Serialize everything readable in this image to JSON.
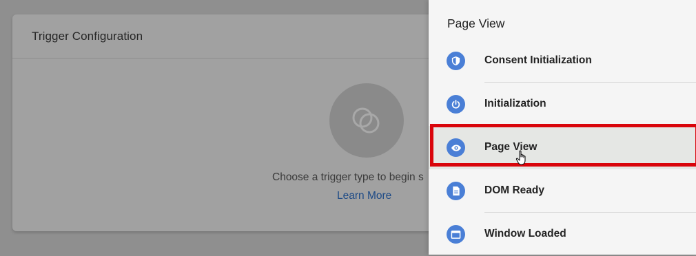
{
  "background_card": {
    "title": "Trigger Configuration",
    "hint": "Choose a trigger type to begin s",
    "link": "Learn More"
  },
  "drawer": {
    "title": "Page View",
    "items": [
      {
        "label": "Consent Initialization",
        "icon": "shield-icon"
      },
      {
        "label": "Initialization",
        "icon": "power-icon"
      },
      {
        "label": "Page View",
        "icon": "eye-icon",
        "selected": true
      },
      {
        "label": "DOM Ready",
        "icon": "document-icon"
      },
      {
        "label": "Window Loaded",
        "icon": "window-icon"
      }
    ]
  },
  "colors": {
    "icon_blue": "#4a7fd6",
    "highlight_red": "#d9050b",
    "link_blue": "#1d4a86"
  }
}
